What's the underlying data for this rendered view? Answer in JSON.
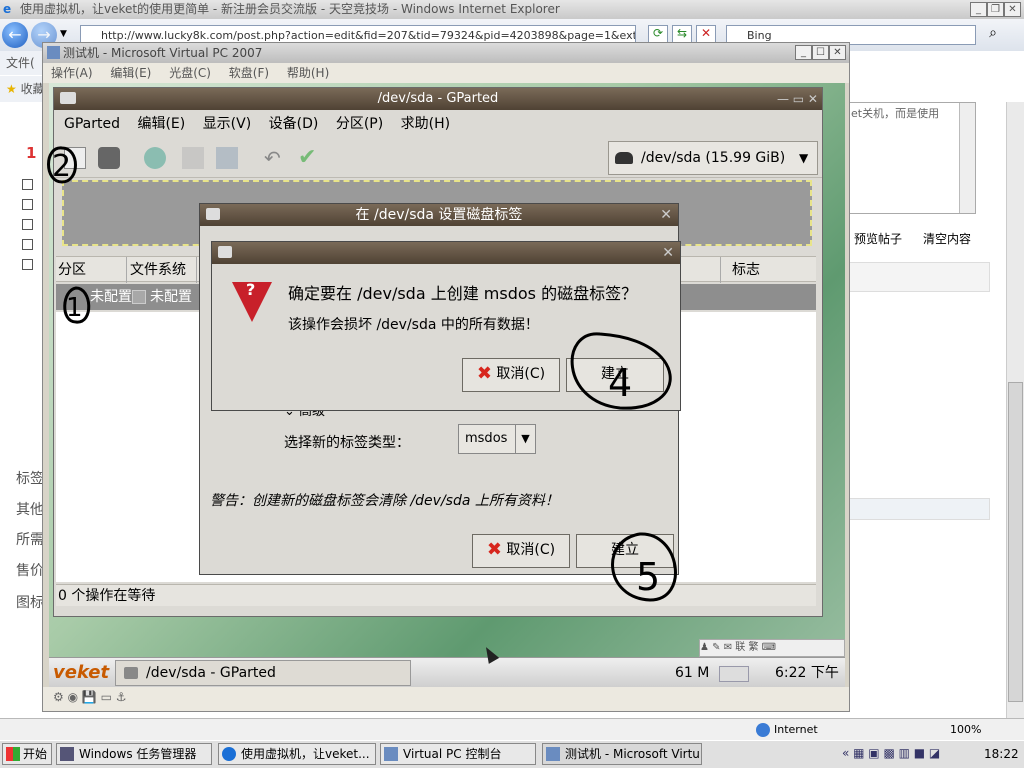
{
  "ie": {
    "title": "使用虚拟机，让veket的使用更简单 - 新注册会员交流版 - 天空竞技场 - Windows Internet Explorer",
    "address": "http://www.lucky8k.com/post.php?action=edit&fid=207&tid=79324&pid=4203898&page=1&extra=page%3",
    "search_placeholder": "Bing",
    "menu_file": "文件(",
    "fav_label": "收藏",
    "status_zone": "Internet",
    "zoom": "100%"
  },
  "webpage": {
    "side_number": "1",
    "right_text": "et关机，而是使用",
    "preview_btn": "预览帖子",
    "clear_btn": "清空内容",
    "left_labels": [
      "标签",
      "其他",
      "所需",
      "售价",
      "图标"
    ]
  },
  "vpc": {
    "title": "测试机 - Microsoft Virtual PC 2007",
    "menu": [
      "操作(A)",
      "编辑(E)",
      "光盘(C)",
      "软盘(F)",
      "帮助(H)"
    ]
  },
  "gparted": {
    "title": "/dev/sda - GParted",
    "menu": [
      "GParted",
      "编辑(E)",
      "显示(V)",
      "设备(D)",
      "分区(P)",
      "求助(H)"
    ],
    "device": "/dev/sda  (15.99 GiB)",
    "columns": [
      "分区",
      "文件系统",
      "标志"
    ],
    "row": [
      "未配置",
      "未配置"
    ],
    "status": "0 个操作在等待"
  },
  "label_dialog": {
    "title": "在 /dev/sda 设置磁盘标签",
    "advanced": "高级",
    "select_label": "选择新的标签类型：",
    "select_value": "msdos",
    "warning": "警告：创建新的磁盘标签会清除 /dev/sda 上所有资料！",
    "cancel": "取消(C)",
    "create": "建立"
  },
  "confirm_dialog": {
    "heading": "确定要在 /dev/sda 上创建 msdos 的磁盘标签？",
    "body": "该操作会损坏 /dev/sda 中的所有数据！",
    "cancel": "取消(C)",
    "create": "建立"
  },
  "guest_taskbar": {
    "logo": "veket",
    "task": "/dev/sda - GParted",
    "mem": "61 M",
    "clock": "6:22 下午",
    "tray_text": "联 繁"
  },
  "annotations": [
    "2",
    "1",
    "4",
    "5"
  ],
  "taskbar": {
    "start": "开始",
    "buttons": [
      "Windows 任务管理器",
      "使用虚拟机，让veket...",
      "Virtual PC 控制台",
      "测试机 - Microsoft Virtu..."
    ],
    "clock": "18:22"
  }
}
